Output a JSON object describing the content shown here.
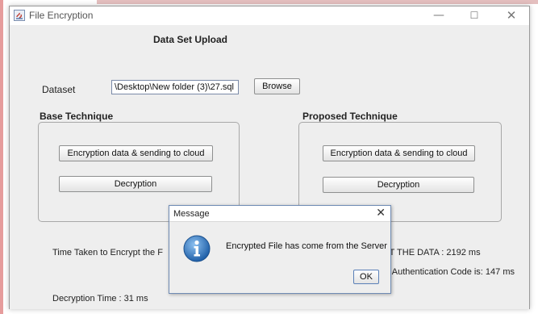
{
  "window": {
    "title": "File Encryption",
    "controls": {
      "minimize": "—",
      "maximize": "☐",
      "close": "✕"
    }
  },
  "main": {
    "heading": "Data Set Upload",
    "dataset_label": "Dataset",
    "dataset_value": "\\Desktop\\New folder (3)\\27.sql",
    "browse_label": "Browse"
  },
  "base": {
    "title": "Base Technique",
    "encrypt_label": "Encryption data & sending to cloud",
    "decrypt_label": "Decryption"
  },
  "proposed": {
    "title": "Proposed Technique",
    "encrypt_label": "Encryption data & sending to cloud",
    "decrypt_label": "Decryption"
  },
  "results": {
    "base_encrypt_time": "Time Taken to Encrypt the F",
    "proposed_encrypt_time": "YPT THE DATA : 2192 ms",
    "auth_code_time": "the Authentication Code is: 147 ms",
    "decryption_time": "Decryption Time  : 31 ms"
  },
  "dialog": {
    "title": "Message",
    "message": "Encrypted File has come from the Server",
    "ok_label": "OK",
    "close": "✕",
    "icon": "information-icon"
  },
  "colors": {
    "info_icon": "#2f6fb8",
    "window_bg": "#eeeeee"
  }
}
